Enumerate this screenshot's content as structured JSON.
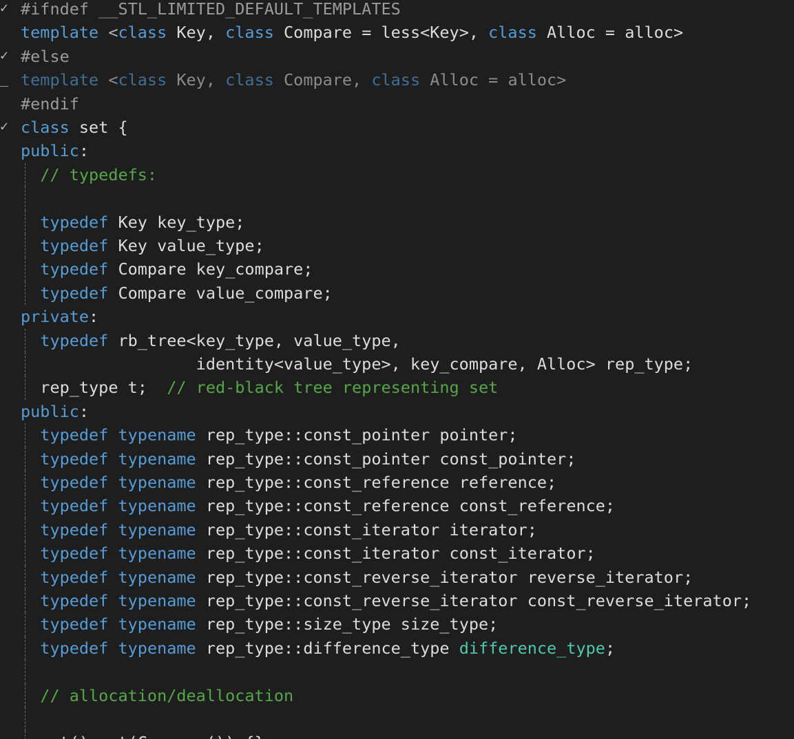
{
  "editor": {
    "language": "C++",
    "colors": {
      "background": "#1e1e1e",
      "keyword": "#569cd6",
      "comment": "#57a64a",
      "text": "#dcdcdc",
      "type": "#4ec9b0"
    },
    "lines": [
      {
        "mark": "✓",
        "guide": false,
        "tokens": [
          {
            "t": "#ifndef __STL_LIMITED_DEFAULT_TEMPLATES",
            "c": "pp"
          }
        ]
      },
      {
        "mark": "",
        "guide": false,
        "tokens": [
          {
            "t": "template",
            "c": "kw"
          },
          {
            "t": " <",
            "c": "punct"
          },
          {
            "t": "class",
            "c": "kw"
          },
          {
            "t": " Key, ",
            "c": "plain"
          },
          {
            "t": "class",
            "c": "kw"
          },
          {
            "t": " Compare = less<Key>, ",
            "c": "plain"
          },
          {
            "t": "class",
            "c": "kw"
          },
          {
            "t": " Alloc = alloc>",
            "c": "plain"
          }
        ]
      },
      {
        "mark": "✓",
        "guide": false,
        "tokens": [
          {
            "t": "#else",
            "c": "pp"
          }
        ]
      },
      {
        "mark": "_",
        "guide": false,
        "tokens": [
          {
            "t": "template",
            "c": "dimkw"
          },
          {
            "t": " <",
            "c": "dim"
          },
          {
            "t": "class",
            "c": "dimkw"
          },
          {
            "t": " Key, ",
            "c": "dim"
          },
          {
            "t": "class",
            "c": "dimkw"
          },
          {
            "t": " Compare, ",
            "c": "dim"
          },
          {
            "t": "class",
            "c": "dimkw"
          },
          {
            "t": " Alloc = alloc>",
            "c": "dim"
          }
        ]
      },
      {
        "mark": "",
        "guide": false,
        "tokens": [
          {
            "t": "#endif",
            "c": "pp"
          }
        ]
      },
      {
        "mark": "✓",
        "guide": false,
        "tokens": [
          {
            "t": "class",
            "c": "kw"
          },
          {
            "t": " set {",
            "c": "plain"
          }
        ]
      },
      {
        "mark": "",
        "guide": false,
        "tokens": [
          {
            "t": "public",
            "c": "kw"
          },
          {
            "t": ":",
            "c": "plain"
          }
        ]
      },
      {
        "mark": "",
        "guide": true,
        "tokens": [
          {
            "t": "  ",
            "c": "plain"
          },
          {
            "t": "// typedefs:",
            "c": "comment"
          }
        ]
      },
      {
        "mark": "",
        "guide": true,
        "tokens": []
      },
      {
        "mark": "",
        "guide": true,
        "tokens": [
          {
            "t": "  ",
            "c": "plain"
          },
          {
            "t": "typedef",
            "c": "kw"
          },
          {
            "t": " Key key_type;",
            "c": "plain"
          }
        ]
      },
      {
        "mark": "",
        "guide": true,
        "tokens": [
          {
            "t": "  ",
            "c": "plain"
          },
          {
            "t": "typedef",
            "c": "kw"
          },
          {
            "t": " Key value_type;",
            "c": "plain"
          }
        ]
      },
      {
        "mark": "",
        "guide": true,
        "tokens": [
          {
            "t": "  ",
            "c": "plain"
          },
          {
            "t": "typedef",
            "c": "kw"
          },
          {
            "t": " Compare key_compare;",
            "c": "plain"
          }
        ]
      },
      {
        "mark": "",
        "guide": true,
        "tokens": [
          {
            "t": "  ",
            "c": "plain"
          },
          {
            "t": "typedef",
            "c": "kw"
          },
          {
            "t": " Compare value_compare;",
            "c": "plain"
          }
        ]
      },
      {
        "mark": "",
        "guide": false,
        "tokens": [
          {
            "t": "private",
            "c": "kw"
          },
          {
            "t": ":",
            "c": "plain"
          }
        ]
      },
      {
        "mark": "",
        "guide": true,
        "tokens": [
          {
            "t": "  ",
            "c": "plain"
          },
          {
            "t": "typedef",
            "c": "kw"
          },
          {
            "t": " rb_tree<key_type, value_type,",
            "c": "plain"
          }
        ]
      },
      {
        "mark": "",
        "guide": true,
        "tokens": [
          {
            "t": "                  identity<value_type>, key_compare, Alloc> rep_type;",
            "c": "plain"
          }
        ]
      },
      {
        "mark": "",
        "guide": true,
        "tokens": [
          {
            "t": "  rep_type t;  ",
            "c": "plain"
          },
          {
            "t": "// red-black tree representing set",
            "c": "comment"
          }
        ]
      },
      {
        "mark": "",
        "guide": false,
        "tokens": [
          {
            "t": "public",
            "c": "kw"
          },
          {
            "t": ":",
            "c": "plain"
          }
        ]
      },
      {
        "mark": "",
        "guide": true,
        "tokens": [
          {
            "t": "  ",
            "c": "plain"
          },
          {
            "t": "typedef",
            "c": "kw"
          },
          {
            "t": " ",
            "c": "plain"
          },
          {
            "t": "typename",
            "c": "kw"
          },
          {
            "t": " rep_type::const_pointer pointer;",
            "c": "plain"
          }
        ]
      },
      {
        "mark": "",
        "guide": true,
        "tokens": [
          {
            "t": "  ",
            "c": "plain"
          },
          {
            "t": "typedef",
            "c": "kw"
          },
          {
            "t": " ",
            "c": "plain"
          },
          {
            "t": "typename",
            "c": "kw"
          },
          {
            "t": " rep_type::const_pointer const_pointer;",
            "c": "plain"
          }
        ]
      },
      {
        "mark": "",
        "guide": true,
        "tokens": [
          {
            "t": "  ",
            "c": "plain"
          },
          {
            "t": "typedef",
            "c": "kw"
          },
          {
            "t": " ",
            "c": "plain"
          },
          {
            "t": "typename",
            "c": "kw"
          },
          {
            "t": " rep_type::const_reference reference;",
            "c": "plain"
          }
        ]
      },
      {
        "mark": "",
        "guide": true,
        "tokens": [
          {
            "t": "  ",
            "c": "plain"
          },
          {
            "t": "typedef",
            "c": "kw"
          },
          {
            "t": " ",
            "c": "plain"
          },
          {
            "t": "typename",
            "c": "kw"
          },
          {
            "t": " rep_type::const_reference const_reference;",
            "c": "plain"
          }
        ]
      },
      {
        "mark": "",
        "guide": true,
        "tokens": [
          {
            "t": "  ",
            "c": "plain"
          },
          {
            "t": "typedef",
            "c": "kw"
          },
          {
            "t": " ",
            "c": "plain"
          },
          {
            "t": "typename",
            "c": "kw"
          },
          {
            "t": " rep_type::const_iterator iterator;",
            "c": "plain"
          }
        ]
      },
      {
        "mark": "",
        "guide": true,
        "tokens": [
          {
            "t": "  ",
            "c": "plain"
          },
          {
            "t": "typedef",
            "c": "kw"
          },
          {
            "t": " ",
            "c": "plain"
          },
          {
            "t": "typename",
            "c": "kw"
          },
          {
            "t": " rep_type::const_iterator const_iterator;",
            "c": "plain"
          }
        ]
      },
      {
        "mark": "",
        "guide": true,
        "tokens": [
          {
            "t": "  ",
            "c": "plain"
          },
          {
            "t": "typedef",
            "c": "kw"
          },
          {
            "t": " ",
            "c": "plain"
          },
          {
            "t": "typename",
            "c": "kw"
          },
          {
            "t": " rep_type::const_reverse_iterator reverse_iterator;",
            "c": "plain"
          }
        ]
      },
      {
        "mark": "",
        "guide": true,
        "tokens": [
          {
            "t": "  ",
            "c": "plain"
          },
          {
            "t": "typedef",
            "c": "kw"
          },
          {
            "t": " ",
            "c": "plain"
          },
          {
            "t": "typename",
            "c": "kw"
          },
          {
            "t": " rep_type::const_reverse_iterator const_reverse_iterator;",
            "c": "plain"
          }
        ]
      },
      {
        "mark": "",
        "guide": true,
        "tokens": [
          {
            "t": "  ",
            "c": "plain"
          },
          {
            "t": "typedef",
            "c": "kw"
          },
          {
            "t": " ",
            "c": "plain"
          },
          {
            "t": "typename",
            "c": "kw"
          },
          {
            "t": " rep_type::size_type size_type;",
            "c": "plain"
          }
        ]
      },
      {
        "mark": "",
        "guide": true,
        "tokens": [
          {
            "t": "  ",
            "c": "plain"
          },
          {
            "t": "typedef",
            "c": "kw"
          },
          {
            "t": " ",
            "c": "plain"
          },
          {
            "t": "typename",
            "c": "kw"
          },
          {
            "t": " rep_type::difference_type ",
            "c": "plain"
          },
          {
            "t": "difference_type",
            "c": "type"
          },
          {
            "t": ";",
            "c": "plain"
          }
        ]
      },
      {
        "mark": "",
        "guide": true,
        "tokens": []
      },
      {
        "mark": "",
        "guide": true,
        "tokens": [
          {
            "t": "  ",
            "c": "plain"
          },
          {
            "t": "// allocation/deallocation",
            "c": "comment"
          }
        ]
      },
      {
        "mark": "",
        "guide": true,
        "tokens": []
      },
      {
        "mark": "",
        "guide": true,
        "tokens": [
          {
            "t": "  set() : t(Compare()) {}",
            "c": "plain"
          }
        ]
      }
    ]
  }
}
